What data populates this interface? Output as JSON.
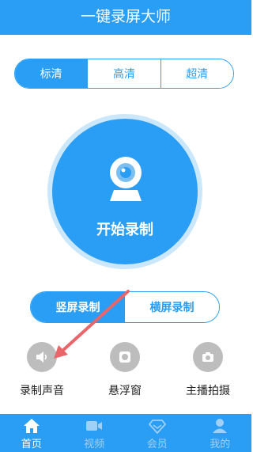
{
  "app": {
    "title": "一键录屏大师"
  },
  "quality": {
    "options": [
      "标清",
      "高清",
      "超清"
    ],
    "selected": "标清"
  },
  "record": {
    "label": "开始录制"
  },
  "orientation": {
    "options": [
      "竖屏录制",
      "横屏录制"
    ],
    "selected": "竖屏录制"
  },
  "features": [
    {
      "label": "录制声音",
      "icon": "speaker-icon"
    },
    {
      "label": "悬浮窗",
      "icon": "floating-window-icon"
    },
    {
      "label": "主播拍摄",
      "icon": "camera-icon"
    }
  ],
  "nav": {
    "items": [
      {
        "label": "首页",
        "icon": "home-icon"
      },
      {
        "label": "视频",
        "icon": "video-icon"
      },
      {
        "label": "会员",
        "icon": "diamond-icon"
      },
      {
        "label": "我的",
        "icon": "user-icon"
      }
    ],
    "active": "首页"
  },
  "colors": {
    "primary": "#2a9df4",
    "ring": "#cbe7fb",
    "feature_icon_bg": "#bdbdbd",
    "annotation_arrow": "#e8666a"
  }
}
